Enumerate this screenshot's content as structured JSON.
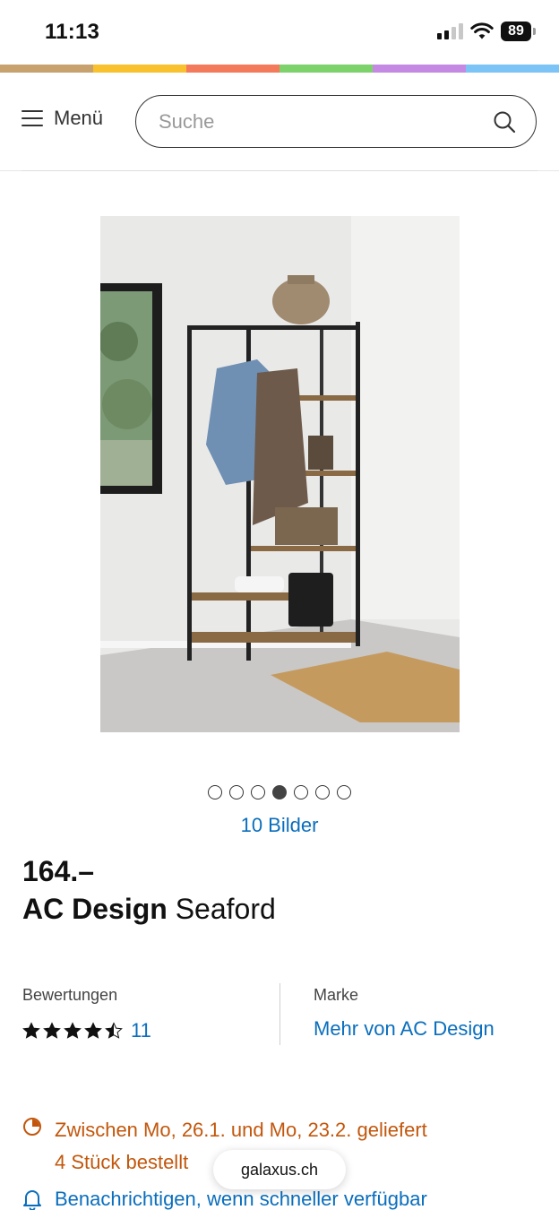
{
  "status_bar": {
    "time": "11:13",
    "battery": "89",
    "icons": [
      "signal-icon",
      "wifi-icon",
      "battery-icon"
    ]
  },
  "brand_stripe_colors": [
    "#c8a26e",
    "#f8c12d",
    "#f47a5c",
    "#7ed26b",
    "#c48ae3",
    "#7cc4f6"
  ],
  "header": {
    "menu_label": "Menü",
    "search_placeholder": "Suche"
  },
  "gallery": {
    "dot_count": 7,
    "active_dot": 3,
    "images_label": "10 Bilder"
  },
  "product": {
    "price": "164.–",
    "brand": "AC Design",
    "name": "Seaford"
  },
  "ratings": {
    "label": "Bewertungen",
    "stars": 4.5,
    "count": "11"
  },
  "brand_info": {
    "label": "Marke",
    "link": "Mehr von AC Design"
  },
  "delivery": {
    "line1": "Zwischen Mo, 26.1. und Mo, 23.2. geliefert",
    "line2": "4 Stück bestellt",
    "notify": "Benachrichtigen, wenn schneller verfügbar"
  },
  "browser": {
    "url": "galaxus.ch"
  },
  "colors": {
    "link": "#0a6ebd",
    "delivery": "#c2570c"
  }
}
